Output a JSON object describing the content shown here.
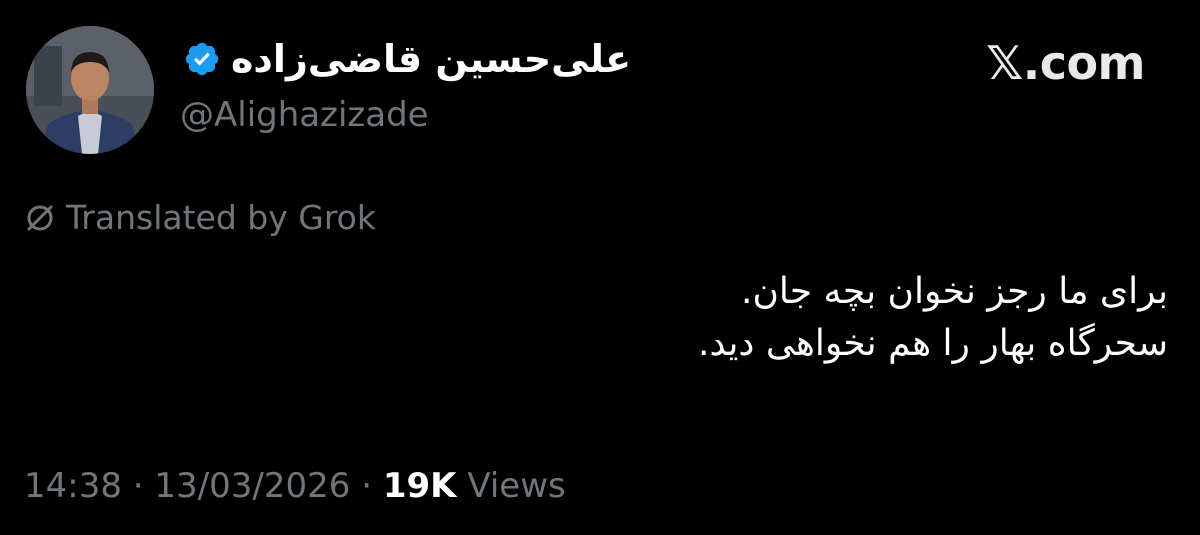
{
  "author": {
    "display_name": "علی‌حسین قاضی‌زاده",
    "handle": "@Alighazizade",
    "verified": true,
    "verified_color": "#1d9bf0"
  },
  "brand": "𝕏.com",
  "translation_notice": "Translated by Grok",
  "tweet": {
    "lines": [
      "برای ما رجز نخوان بچه جان.",
      "سحرگاه بهار را هم نخواهی دید."
    ]
  },
  "meta": {
    "time": "14:38",
    "separator": " · ",
    "date": "13/03/2026",
    "views_count": "19K",
    "views_label": "Views"
  },
  "icons": {
    "avatar": "profile-photo",
    "verified": "verified-badge-icon",
    "translate": "translate-slash-icon"
  }
}
